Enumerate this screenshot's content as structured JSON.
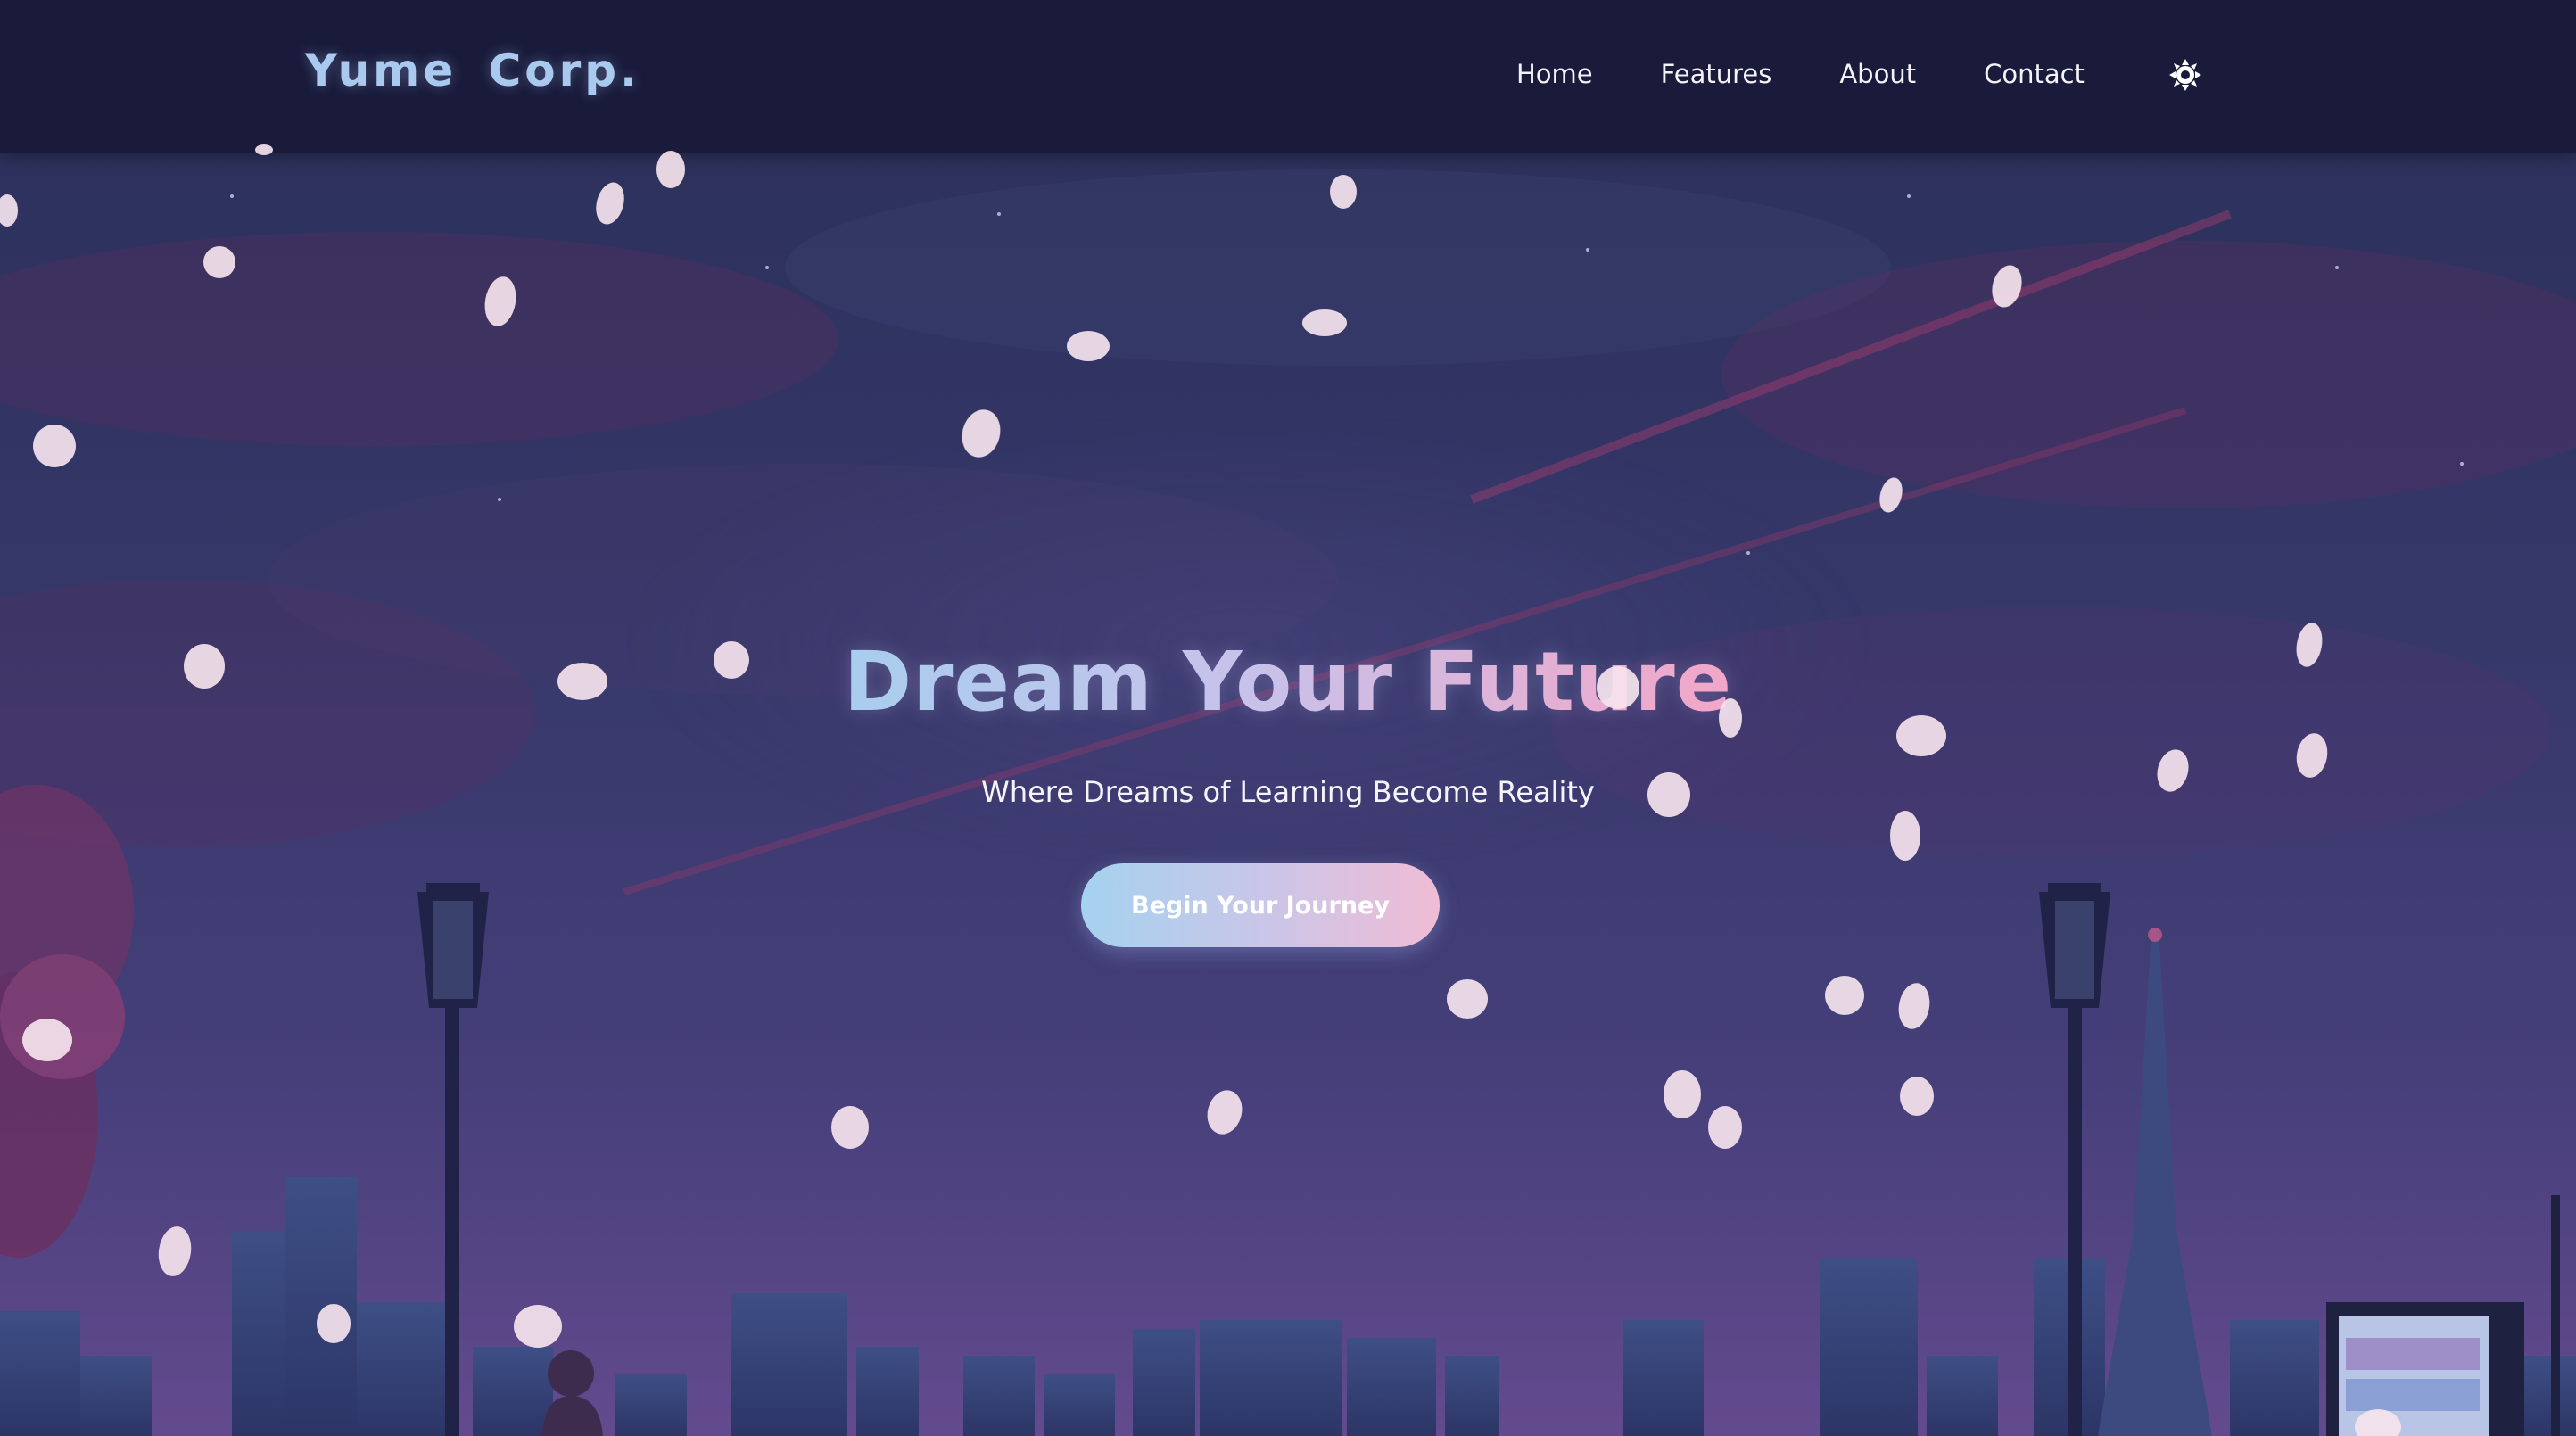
{
  "navbar": {
    "brand": "Yume Corp.",
    "links": [
      {
        "label": "Home"
      },
      {
        "label": "Features"
      },
      {
        "label": "About"
      },
      {
        "label": "Contact"
      }
    ],
    "theme_toggle_icon": "sun-icon"
  },
  "hero": {
    "title": "Dream Your Future",
    "subtitle": "Where Dreams of Learning Become Reality",
    "cta_label": "Begin Your Journey"
  },
  "colors": {
    "navbar_bg": "#1a1a3a",
    "brand": "#a9c9ee",
    "title_gradient_start": "#a9cdee",
    "title_gradient_end": "#f3a6c8",
    "cta_gradient_start": "#a5d2ef",
    "cta_gradient_end": "#f0bcd5",
    "sky_top": "#2b3159",
    "sky_bottom": "#5a4488",
    "petal": "#f7e4ee"
  },
  "background": {
    "scene": "night-city-skyline",
    "elements": [
      "street-lamp",
      "street-lamp",
      "tv-tower",
      "cherry-blossom-tree",
      "person-silhouette",
      "vending-machine"
    ]
  }
}
